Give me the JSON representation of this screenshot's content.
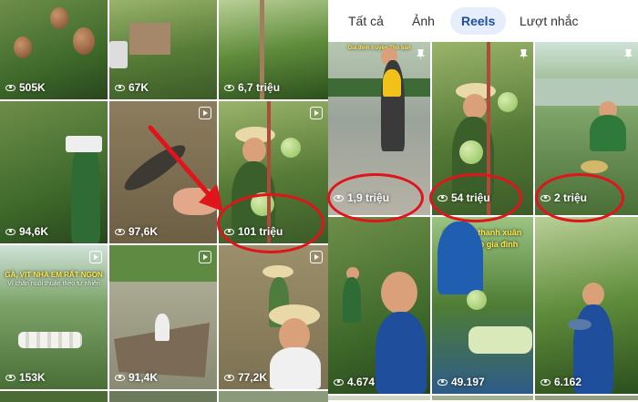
{
  "tabs": [
    {
      "label": "Tất cả"
    },
    {
      "label": "Ảnh"
    },
    {
      "label": "Reels"
    },
    {
      "label": "Lượt nhắc"
    }
  ],
  "left_tiles": [
    {
      "views": "505K"
    },
    {
      "views": "67K"
    },
    {
      "views": "6,7 triệu"
    },
    {
      "views": "94,6K"
    },
    {
      "views": "97,6K"
    },
    {
      "views": "101 triệu"
    },
    {
      "views": "153K",
      "caption": "GÀ, VỊT NHÀ EM RẤT NGON",
      "subcaption": "Vì chăn nuôi thuận theo tự nhiên"
    },
    {
      "views": "91,4K"
    },
    {
      "views": "77,2K"
    }
  ],
  "right_tiles": [
    {
      "views": "1,9 triệu",
      "caption": "Gia đình truyền Thổ bản"
    },
    {
      "views": "54 triệu"
    },
    {
      "views": "2 triệu"
    },
    {
      "views": "4.674"
    },
    {
      "views": "49.197",
      "caption": "Dành cả thanh xuân",
      "subcaption": "Để lo cho gia đình"
    },
    {
      "views": "6.162"
    }
  ],
  "colors": {
    "highlight": "#e0141b",
    "tab_active_bg": "#e6eefc",
    "tab_active_text": "#1f4fa0"
  },
  "icons": [
    "eye-icon",
    "reels-icon",
    "pin-icon",
    "arrow-annotation"
  ]
}
